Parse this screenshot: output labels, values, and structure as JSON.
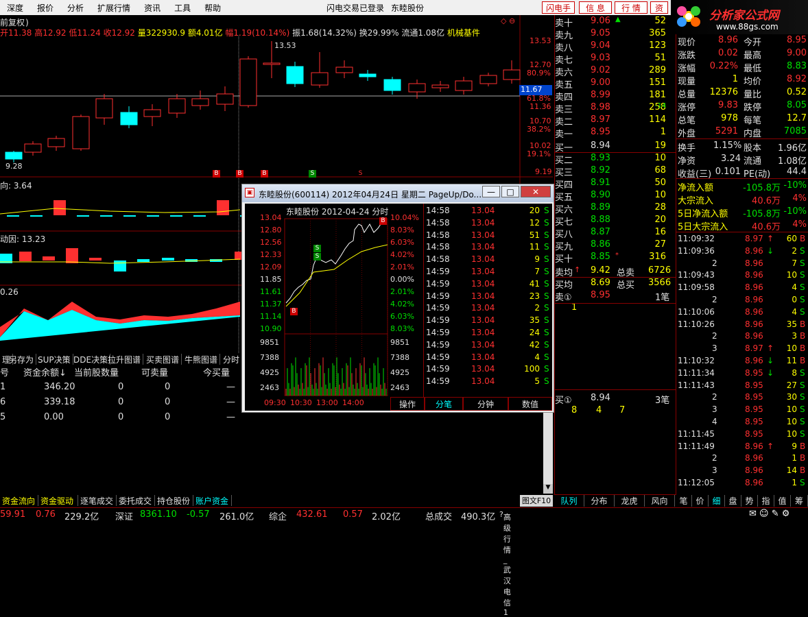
{
  "menu": [
    "深度",
    "报价",
    "分析",
    "扩展行情",
    "资讯",
    "工具",
    "帮助"
  ],
  "menu_status": "闪电交易已登录",
  "menu_stock": "东睦股份",
  "top_buttons": [
    "闪电手",
    "信 息",
    "行 情",
    "资"
  ],
  "logo": {
    "text": "分析家公式网",
    "url": "www.88gs.com"
  },
  "chart_header": {
    "fq": "前复权)",
    "open": "开11.38",
    "high": "高12.92",
    "low": "低11.24",
    "close": "收12.92",
    "vol": "量322930.9",
    "amt": "额4.01亿",
    "chg": "幅1.19(10.14%)",
    "amp": "振1.68(14.32%)",
    "turn": "换29.99%",
    "float": "流通1.08亿",
    "sector": "机械基件"
  },
  "price_axis": [
    "13.53",
    "12.70",
    "80.9%",
    "61.8%",
    "11.36",
    "10.70",
    "38.2%",
    "10.02",
    "19.1%",
    "9.19"
  ],
  "price_marker": "11.67",
  "high_label": "13.53",
  "low_label": "9.28",
  "bs_marks": [
    "B",
    "B",
    "B",
    "S",
    "S"
  ],
  "sub1": {
    "label": "向: 3.64"
  },
  "sub2": {
    "label": "动因: 13.23"
  },
  "sub3": {
    "label": "0.26"
  },
  "toolbar_tabs": [
    "理",
    "另存为",
    "SUP决策",
    "DDE决策",
    "拉升图谱",
    "买卖图谱",
    "牛熊图谱",
    "分时"
  ],
  "account": {
    "headers": [
      "号",
      "资金余额↓",
      "当前股数量",
      "可卖量",
      "今买量"
    ],
    "rows": [
      {
        "id": "1",
        "bal": "346.20",
        "qty": "0",
        "sell": "0",
        "buy": "—"
      },
      {
        "id": "6",
        "bal": "339.18",
        "qty": "0",
        "sell": "0",
        "buy": "—"
      },
      {
        "id": "5",
        "bal": "0.00",
        "qty": "0",
        "sell": "0",
        "buy": "—"
      }
    ]
  },
  "bottom_tabs": [
    "资金流向",
    "资金驱动",
    "逐笔成交",
    "委托成交",
    "持仓股份",
    "账户资金"
  ],
  "order_book": {
    "sells": [
      {
        "label": "卖十",
        "price": "9.06",
        "vol": "52",
        "mark": "▲",
        "chg": ""
      },
      {
        "label": "卖九",
        "price": "9.05",
        "vol": "365",
        "mark": "",
        "chg": ""
      },
      {
        "label": "卖八",
        "price": "9.04",
        "vol": "123",
        "mark": "",
        "chg": ""
      },
      {
        "label": "卖七",
        "price": "9.03",
        "vol": "51",
        "mark": "",
        "chg": ""
      },
      {
        "label": "卖六",
        "price": "9.02",
        "vol": "289",
        "mark": "",
        "chg": ""
      },
      {
        "label": "卖五",
        "price": "9.00",
        "vol": "151",
        "mark": "",
        "chg": ""
      },
      {
        "label": "卖四",
        "price": "8.99",
        "vol": "181",
        "mark": "",
        "chg": ""
      },
      {
        "label": "卖三",
        "price": "8.98",
        "vol": "258",
        "mark": "",
        "chg": "-14"
      },
      {
        "label": "卖二",
        "price": "8.97",
        "vol": "114",
        "mark": "",
        "chg": ""
      },
      {
        "label": "卖一",
        "price": "8.95",
        "vol": "1",
        "mark": "",
        "chg": ""
      }
    ],
    "buys": [
      {
        "label": "买一",
        "price": "8.94",
        "vol": "19",
        "mark": ""
      },
      {
        "label": "买二",
        "price": "8.93",
        "vol": "10",
        "mark": ""
      },
      {
        "label": "买三",
        "price": "8.92",
        "vol": "68",
        "mark": ""
      },
      {
        "label": "买四",
        "price": "8.91",
        "vol": "50",
        "mark": ""
      },
      {
        "label": "买五",
        "price": "8.90",
        "vol": "10",
        "mark": ""
      },
      {
        "label": "买六",
        "price": "8.89",
        "vol": "28",
        "mark": ""
      },
      {
        "label": "买七",
        "price": "8.88",
        "vol": "20",
        "mark": ""
      },
      {
        "label": "买八",
        "price": "8.87",
        "vol": "16",
        "mark": ""
      },
      {
        "label": "买九",
        "price": "8.86",
        "vol": "27",
        "mark": ""
      },
      {
        "label": "买十",
        "price": "8.85",
        "vol": "316",
        "mark": "*"
      }
    ],
    "avg": [
      {
        "label": "卖均",
        "price": "9.42",
        "arrow": "↑",
        "label2": "总卖",
        "total": "6726"
      },
      {
        "label": "买均",
        "price": "8.69",
        "arrow": "",
        "label2": "总买",
        "total": "3566"
      }
    ],
    "sell1": {
      "label": "卖①",
      "price": "8.95",
      "count": "1笔",
      "detail": "1"
    },
    "buy1": {
      "label": "买①",
      "price": "8.94",
      "count": "3笔",
      "detail": [
        "8",
        "4",
        "7"
      ]
    },
    "tabs": [
      "队列",
      "分布",
      "龙虎",
      "风向"
    ],
    "fig10": "图文F10"
  },
  "quote": {
    "rows": [
      [
        "现价",
        "8.96",
        "今开",
        "8.95"
      ],
      [
        "涨跌",
        "0.02",
        "最高",
        "9.00"
      ],
      [
        "涨幅",
        "0.22%",
        "最低",
        "8.83"
      ],
      [
        "现量",
        "1",
        "均价",
        "8.92"
      ],
      [
        "总量",
        "12376",
        "量比",
        "0.52"
      ],
      [
        "涨停",
        "9.83",
        "跌停",
        "8.05"
      ],
      [
        "总笔",
        "978",
        "每笔",
        "12.7"
      ],
      [
        "外盘",
        "5291",
        "内盘",
        "7085"
      ]
    ],
    "rows2": [
      [
        "换手",
        "1.15%",
        "股本",
        "1.96亿"
      ],
      [
        "净资",
        "3.24",
        "流通",
        "1.08亿"
      ],
      [
        "收益(三)",
        "0.101",
        "PE(动)",
        "44.4"
      ]
    ],
    "flows": [
      [
        "净流入额",
        "-105.8万",
        "-10%"
      ],
      [
        "大宗流入",
        "40.6万",
        "4%"
      ],
      [
        "5日净流入额",
        "-105.8万",
        "-10%"
      ],
      [
        "5日大宗流入",
        "40.6万",
        "4%"
      ]
    ]
  },
  "ticks": [
    {
      "t": "11:09:32",
      "p": "8.97",
      "a": "↑",
      "v": "60",
      "s": "B"
    },
    {
      "t": "11:09:36",
      "p": "8.96",
      "a": "↓",
      "v": "2",
      "s": "S"
    },
    {
      "t": "2",
      "p": "8.96",
      "a": "",
      "v": "7",
      "s": "S"
    },
    {
      "t": "11:09:43",
      "p": "8.96",
      "a": "",
      "v": "10",
      "s": "S"
    },
    {
      "t": "11:09:58",
      "p": "8.96",
      "a": "",
      "v": "4",
      "s": "S"
    },
    {
      "t": "2",
      "p": "8.96",
      "a": "",
      "v": "0",
      "s": "S"
    },
    {
      "t": "11:10:06",
      "p": "8.96",
      "a": "",
      "v": "4",
      "s": "S"
    },
    {
      "t": "11:10:26",
      "p": "8.96",
      "a": "",
      "v": "35",
      "s": "B"
    },
    {
      "t": "2",
      "p": "8.96",
      "a": "",
      "v": "3",
      "s": "B"
    },
    {
      "t": "3",
      "p": "8.97",
      "a": "↑",
      "v": "10",
      "s": "B"
    },
    {
      "t": "11:10:32",
      "p": "8.96",
      "a": "↓",
      "v": "11",
      "s": "B"
    },
    {
      "t": "11:11:34",
      "p": "8.95",
      "a": "↓",
      "v": "8",
      "s": "S"
    },
    {
      "t": "11:11:43",
      "p": "8.95",
      "a": "",
      "v": "27",
      "s": "S"
    },
    {
      "t": "2",
      "p": "8.95",
      "a": "",
      "v": "30",
      "s": "S"
    },
    {
      "t": "3",
      "p": "8.95",
      "a": "",
      "v": "10",
      "s": "S"
    },
    {
      "t": "4",
      "p": "8.95",
      "a": "",
      "v": "10",
      "s": "S"
    },
    {
      "t": "11:11:45",
      "p": "8.95",
      "a": "",
      "v": "10",
      "s": "S"
    },
    {
      "t": "11:11:49",
      "p": "8.96",
      "a": "↑",
      "v": "9",
      "s": "B"
    },
    {
      "t": "2",
      "p": "8.96",
      "a": "",
      "v": "1",
      "s": "B"
    },
    {
      "t": "3",
      "p": "8.96",
      "a": "",
      "v": "14",
      "s": "B"
    },
    {
      "t": "11:12:05",
      "p": "8.96",
      "a": "",
      "v": "1",
      "s": "S"
    }
  ],
  "right_tabs": [
    "笔",
    "价",
    "细",
    "盘",
    "势",
    "指",
    "值",
    "筹"
  ],
  "popup": {
    "title": "东睦股份(600114) 2012年04月24日 星期二 PageUp/Do...",
    "chart_title": "东睦股份   2012-04-24 分时",
    "left_axis": [
      "13.04",
      "12.80",
      "12.56",
      "12.33",
      "12.09",
      "11.85",
      "11.61",
      "11.37",
      "11.14",
      "10.90",
      "9851",
      "7388",
      "4925",
      "2463"
    ],
    "right_axis": [
      "10.04%",
      "8.03%",
      "6.03%",
      "4.02%",
      "2.01%",
      "0.00%",
      "2.01%",
      "4.02%",
      "6.03%",
      "8.03%",
      "9851",
      "7388",
      "4925",
      "2463"
    ],
    "time_axis": [
      "09:30",
      "10:30",
      "13:00",
      "14:00"
    ],
    "ticks": [
      {
        "t": "14:58",
        "p": "13.04",
        "v": "20",
        "s": "S"
      },
      {
        "t": "14:58",
        "p": "13.04",
        "v": "12",
        "s": "S"
      },
      {
        "t": "14:58",
        "p": "13.04",
        "v": "51",
        "s": "S"
      },
      {
        "t": "14:58",
        "p": "13.04",
        "v": "11",
        "s": "S"
      },
      {
        "t": "14:58",
        "p": "13.04",
        "v": "9",
        "s": "S"
      },
      {
        "t": "14:59",
        "p": "13.04",
        "v": "7",
        "s": "S"
      },
      {
        "t": "14:59",
        "p": "13.04",
        "v": "41",
        "s": "S"
      },
      {
        "t": "14:59",
        "p": "13.04",
        "v": "23",
        "s": "S"
      },
      {
        "t": "14:59",
        "p": "13.04",
        "v": "2",
        "s": "S"
      },
      {
        "t": "14:59",
        "p": "13.04",
        "v": "35",
        "s": "S"
      },
      {
        "t": "14:59",
        "p": "13.04",
        "v": "24",
        "s": "S"
      },
      {
        "t": "14:59",
        "p": "13.04",
        "v": "42",
        "s": "S"
      },
      {
        "t": "14:59",
        "p": "13.04",
        "v": "4",
        "s": "S"
      },
      {
        "t": "14:59",
        "p": "13.04",
        "v": "100",
        "s": "S"
      },
      {
        "t": "14:59",
        "p": "13.04",
        "v": "5",
        "s": "S"
      }
    ],
    "tabs": [
      "操作",
      "分笔",
      "分钟",
      "数值"
    ]
  },
  "statusbar": {
    "a": "59.91",
    "b": "0.76",
    "c": "229.2亿",
    "sz_label": "深证",
    "sz_val": "8361.10",
    "sz_chg": "-0.57",
    "sz_amt": "261.0亿",
    "zq_label": "综企",
    "zq_val": "432.61",
    "zq_chg": "0.57",
    "zq_amt": "2.02亿",
    "total_label": "总成交",
    "total_val": "490.3亿",
    "msg": "高级行情_武汉电信1"
  },
  "colors": {
    "up": "#ff3030",
    "down": "#00ffff",
    "volume_down": "#00e000",
    "bg": "#000000",
    "ma": "#ffff00"
  }
}
